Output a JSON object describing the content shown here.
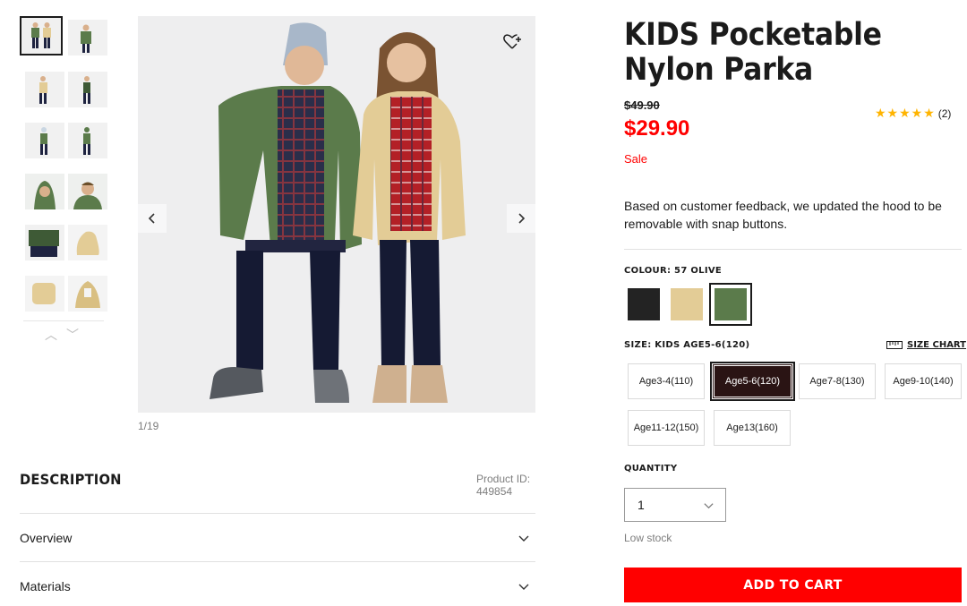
{
  "gallery": {
    "counter": "1/19",
    "thumb_count": 12,
    "prev_icon": "chevron-left-icon",
    "next_icon": "chevron-right-icon",
    "wishlist_icon": "heart-plus-icon"
  },
  "description": {
    "title": "DESCRIPTION",
    "product_id_label": "Product ID:",
    "product_id": "449854",
    "sections": [
      {
        "label": "Overview"
      },
      {
        "label": "Materials"
      }
    ]
  },
  "product": {
    "title": "KIDS Pocketable Nylon Parka",
    "original_price": "$49.90",
    "sale_price": "$29.90",
    "sale_label": "Sale",
    "rating_stars": "★★★★★",
    "rating_value": 5,
    "rating_count": "(2)",
    "blurb": "Based on customer feedback, we updated the hood to be removable with snap buttons."
  },
  "colour": {
    "label": "COLOUR: 57 OLIVE",
    "swatches": [
      {
        "name": "black",
        "hex": "#232323"
      },
      {
        "name": "beige",
        "hex": "#e3cc96"
      },
      {
        "name": "olive",
        "hex": "#5b7b4b",
        "selected": true
      }
    ]
  },
  "size": {
    "label": "SIZE: KIDS AGE5-6(120)",
    "chart_label": "SIZE CHART",
    "chart_icon": "ruler-icon",
    "options": [
      {
        "label": "Age3-4(110)"
      },
      {
        "label": "Age5-6(120)",
        "selected": true
      },
      {
        "label": "Age7-8(130)"
      },
      {
        "label": "Age9-10(140)"
      },
      {
        "label": "Age11-12(150)"
      },
      {
        "label": "Age13(160)"
      }
    ]
  },
  "quantity": {
    "label": "QUANTITY",
    "value": "1",
    "stock_note": "Low stock"
  },
  "cart": {
    "label": "ADD TO CART"
  },
  "colors": {
    "sale_red": "#ff0000",
    "text": "#1b1b1b",
    "muted": "#7d7d7d",
    "selected_size_bg": "#2a1414"
  }
}
